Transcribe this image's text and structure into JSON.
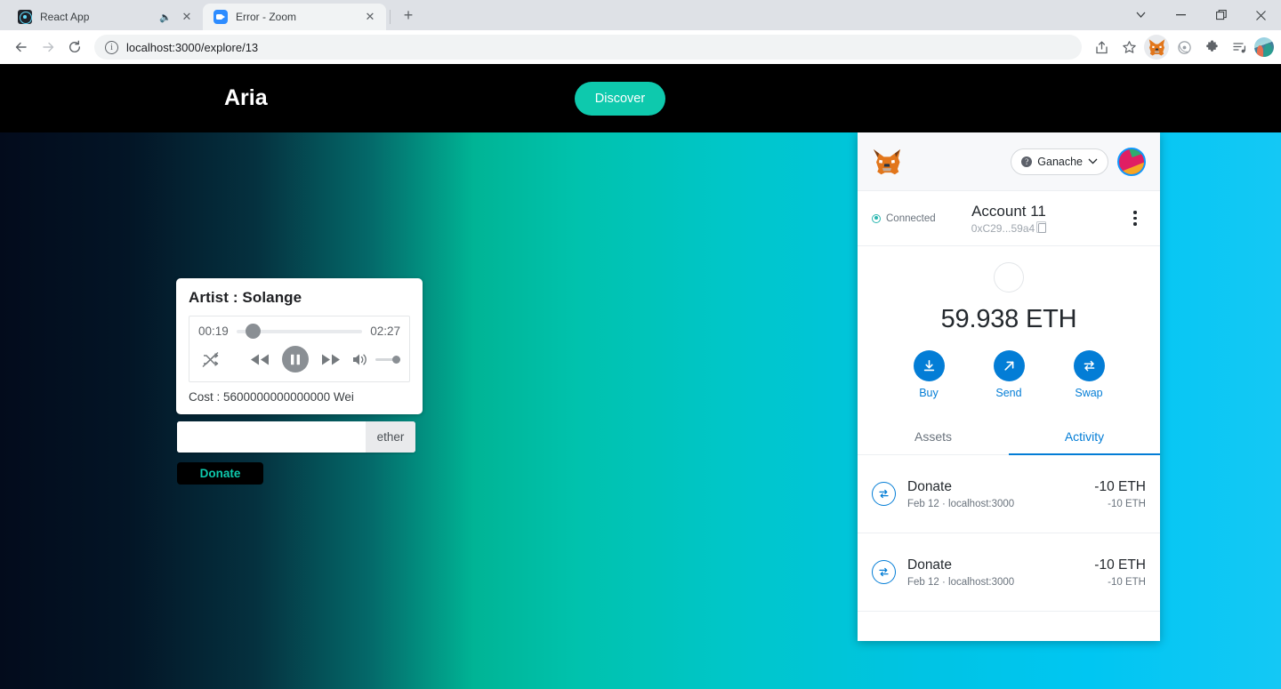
{
  "browser": {
    "tabs": [
      {
        "title": "React App",
        "favicon": "react-icon",
        "active": false,
        "muted": true
      },
      {
        "title": "Error - Zoom",
        "favicon": "zoom-icon",
        "active": true,
        "muted": false
      }
    ],
    "new_tab_label": "+",
    "window_controls": {
      "tab_search": "⌄",
      "minimize": "—",
      "maximize": "❐",
      "close": "✕"
    },
    "nav": {
      "back": "←",
      "forward": "→",
      "reload": "⟳"
    },
    "omnibox": {
      "url": "localhost:3000/explore/13",
      "info_glyph": "i"
    },
    "toolbar_icons": [
      {
        "name": "share-icon",
        "glyph": "➦"
      },
      {
        "name": "bookmark-star-icon",
        "glyph": "☆"
      },
      {
        "name": "metamask-extension-icon",
        "glyph": "fox"
      },
      {
        "name": "circle-extension-icon",
        "glyph": "◎"
      },
      {
        "name": "extensions-puzzle-icon",
        "glyph": "❖"
      },
      {
        "name": "reading-list-icon",
        "glyph": "≣"
      },
      {
        "name": "profile-avatar",
        "glyph": "avatar"
      }
    ]
  },
  "app": {
    "title": "Aria",
    "discover_label": "Discover",
    "player": {
      "artist_label": "Artist : Solange",
      "current_time": "00:19",
      "total_time": "02:27",
      "progress_percent": 13,
      "volume_percent": 100,
      "controls": {
        "shuffle": "shuffle-disabled-icon",
        "rewind": "rewind-icon",
        "play_pause": "pause-icon",
        "forward": "fast-forward-icon",
        "volume": "volume-icon"
      },
      "cost_label": "Cost : 5600000000000000 Wei"
    },
    "donate": {
      "amount_value": "",
      "amount_placeholder": "",
      "unit_label": "ether",
      "button_label": "Donate"
    }
  },
  "metamask": {
    "network": {
      "name": "Ganache",
      "chevron": "⌄"
    },
    "connection_status": "Connected",
    "account": {
      "name": "Account 11",
      "address": "0xC29...59a4"
    },
    "balance": "59.938 ETH",
    "actions": [
      {
        "label": "Buy",
        "icon": "download-arrow-icon"
      },
      {
        "label": "Send",
        "icon": "send-arrow-icon"
      },
      {
        "label": "Swap",
        "icon": "swap-arrows-icon"
      }
    ],
    "tabs": [
      {
        "label": "Assets",
        "active": false
      },
      {
        "label": "Activity",
        "active": true
      }
    ],
    "activity": [
      {
        "title": "Donate",
        "subtitle": "Feb 12 · localhost:3000",
        "amount": "-10 ETH",
        "amount_sub": "-10 ETH",
        "icon": "swap-arrows-icon"
      },
      {
        "title": "Donate",
        "subtitle": "Feb 12 · localhost:3000",
        "amount": "-10 ETH",
        "amount_sub": "-10 ETH",
        "icon": "swap-arrows-icon"
      }
    ]
  },
  "colors": {
    "accent_teal": "#0ec9ad",
    "metamask_blue": "#037dd6",
    "header_black": "#000000"
  }
}
